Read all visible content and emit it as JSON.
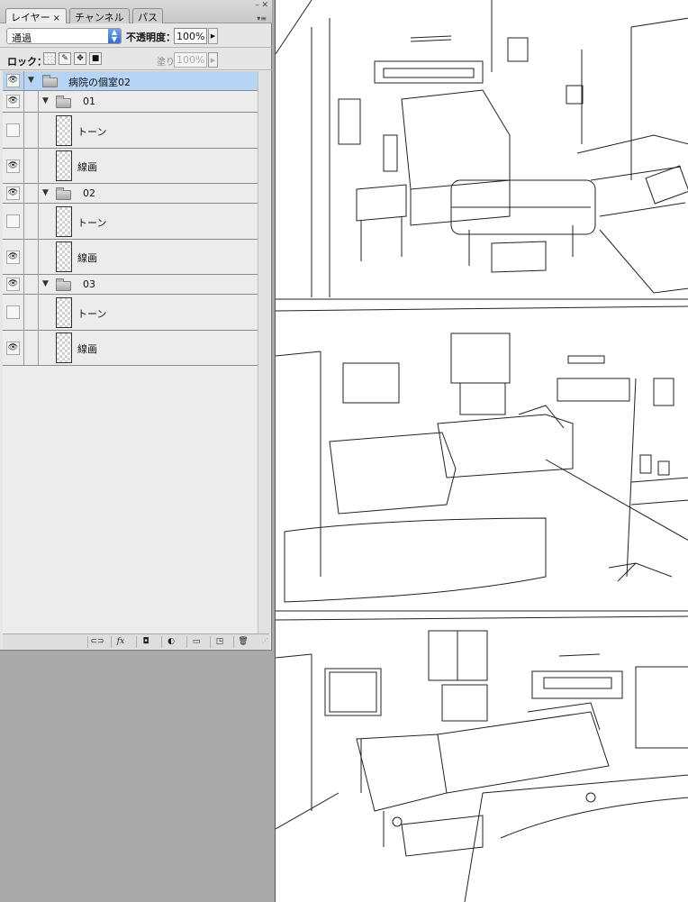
{
  "panel": {
    "tabs": [
      {
        "label": "レイヤー",
        "close": "×",
        "active": true
      },
      {
        "label": "チャンネル",
        "active": false
      },
      {
        "label": "パス",
        "active": false
      }
    ],
    "blend_mode": "通過",
    "opacity_label": "不透明度：",
    "opacity_value": "100%",
    "lock_label": "ロック：",
    "fill_label": "塗り：",
    "fill_value": "100%"
  },
  "layers": [
    {
      "name": "病院の個室02",
      "kind": "group",
      "level": 0,
      "visible": true,
      "selected": true,
      "expanded": true
    },
    {
      "name": "01",
      "kind": "group",
      "level": 1,
      "visible": true,
      "expanded": true
    },
    {
      "name": "トーン",
      "kind": "layer",
      "level": 2,
      "visible": false
    },
    {
      "name": "線画",
      "kind": "layer",
      "level": 2,
      "visible": true
    },
    {
      "name": "02",
      "kind": "group",
      "level": 1,
      "visible": true,
      "expanded": true
    },
    {
      "name": "トーン",
      "kind": "layer",
      "level": 2,
      "visible": false
    },
    {
      "name": "線画",
      "kind": "layer",
      "level": 2,
      "visible": true
    },
    {
      "name": "03",
      "kind": "group",
      "level": 1,
      "visible": true,
      "expanded": true
    },
    {
      "name": "トーン",
      "kind": "layer",
      "level": 2,
      "visible": false
    },
    {
      "name": "線画",
      "kind": "layer",
      "level": 2,
      "visible": true
    }
  ],
  "bottom_icons": [
    "link-icon",
    "fx-icon",
    "mask-icon",
    "adjustment-icon",
    "folder-icon",
    "new-layer-icon",
    "trash-icon"
  ],
  "bottom_glyphs": {
    "link": "⊂⊃",
    "fx": "fx",
    "mask": "◘",
    "adjustment": "◐",
    "folder": "▭",
    "new_layer": "◳",
    "trash": "🗑"
  }
}
